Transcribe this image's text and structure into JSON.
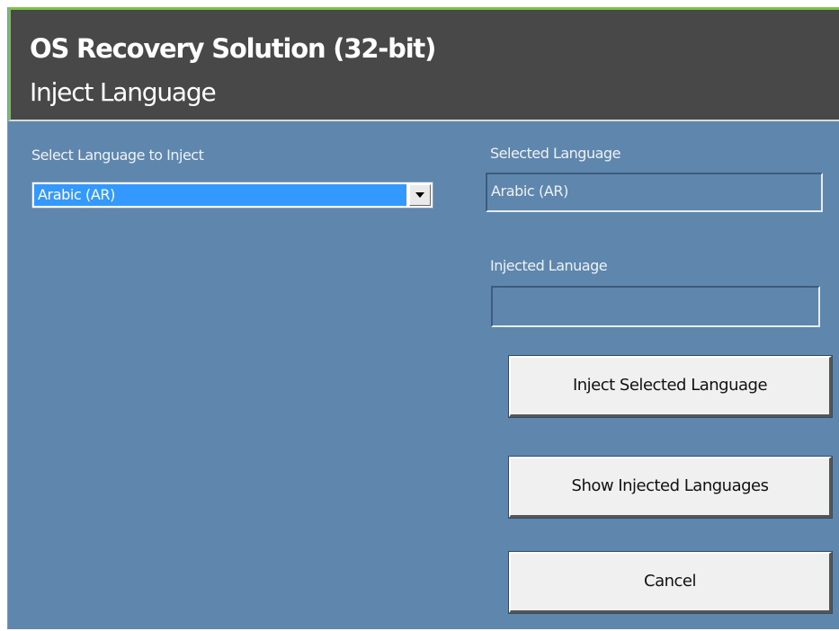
{
  "window": {
    "title": "OS Recovery Solution (32-bit)",
    "subtitle": "Inject Language"
  },
  "form": {
    "select_label": "Select Language to Inject",
    "select_value": "Arabic (AR)",
    "selected_label": "Selected Language",
    "selected_value": "Arabic (AR)",
    "injected_label": "Injected Lanuage",
    "injected_value": ""
  },
  "buttons": {
    "inject": "Inject Selected Language",
    "show": "Show Injected Languages",
    "cancel": "Cancel"
  },
  "icons": {
    "dropdown": "chevron-down-icon"
  },
  "colors": {
    "header_bg": "#484848",
    "accent": "#7cc242",
    "panel_bg": "#5f86ad",
    "selection": "#3399ff"
  }
}
